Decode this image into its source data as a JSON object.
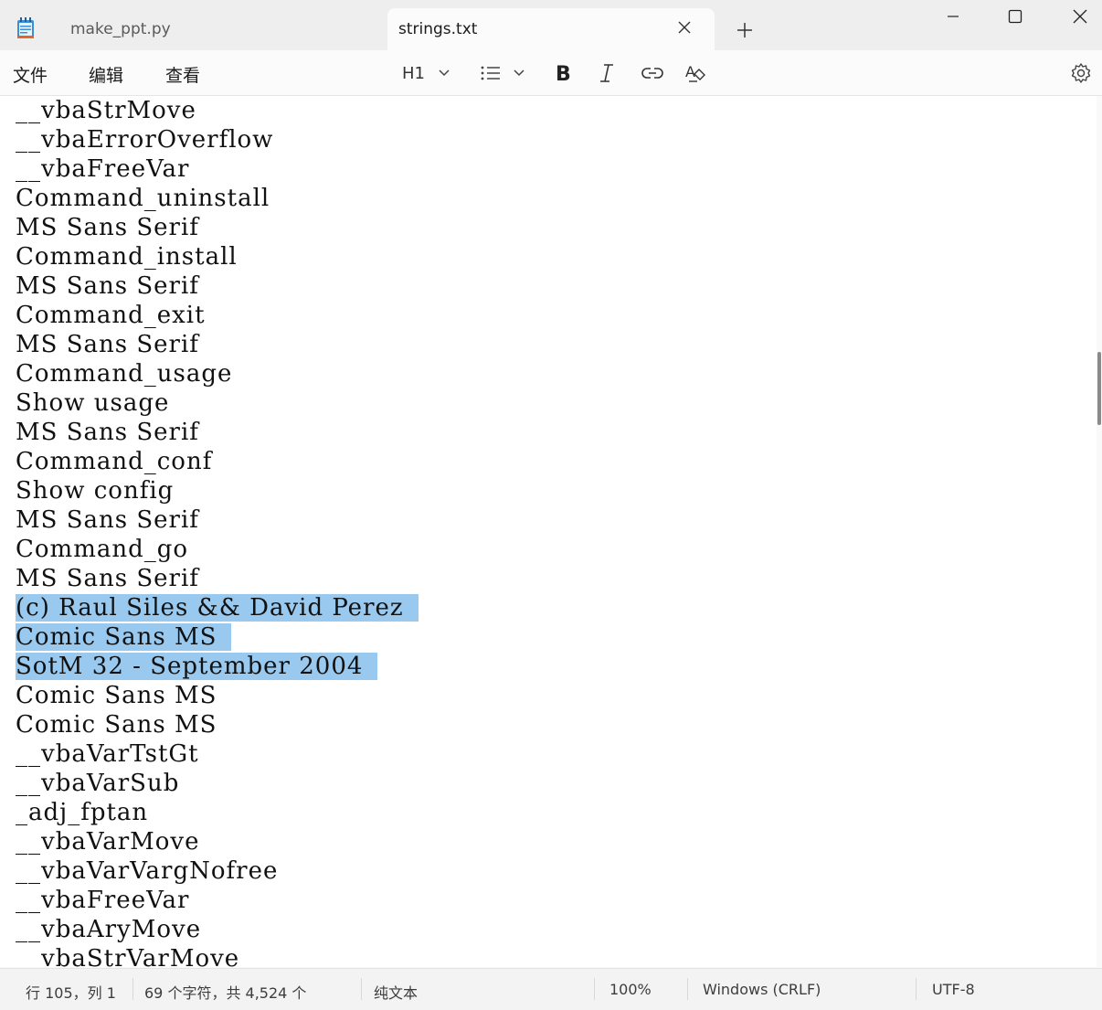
{
  "tabs": [
    {
      "label": "make_ppt.py",
      "icon": "notepad-icon"
    },
    {
      "label": "strings.txt",
      "active": true
    }
  ],
  "menu": [
    "文件",
    "编辑",
    "查看"
  ],
  "toolbar": {
    "heading": "H1",
    "icons": [
      "chevron-down-icon",
      "list-icon",
      "bold-icon",
      "italic-icon",
      "link-icon",
      "clear-format-icon",
      "gear-icon"
    ]
  },
  "editor": {
    "lines": [
      "__vbaStrMove",
      "__vbaErrorOverflow",
      "__vbaFreeVar",
      "Command_uninstall",
      "MS Sans Serif",
      "Command_install",
      "MS Sans Serif",
      "Command_exit",
      "MS Sans Serif",
      "Command_usage",
      "Show usage",
      "MS Sans Serif",
      "Command_conf",
      "Show config",
      "MS Sans Serif",
      "Command_go",
      "MS Sans Serif",
      "(c) Raul Siles && David Perez",
      "Comic Sans MS",
      "SotM 32 - September 2004",
      "Comic Sans MS",
      "Comic Sans MS",
      "__vbaVarTstGt",
      "__vbaVarSub",
      "_adj_fptan",
      "__vbaVarMove",
      "__vbaVarVargNofree",
      "__vbaFreeVar",
      "__vbaAryMove",
      "__vbaStrVarMove"
    ],
    "selected_lines": [
      17,
      18,
      19
    ]
  },
  "status": {
    "position": "行 105，列 1",
    "count": "69 个字符，共 4,524 个",
    "format": "纯文本",
    "zoom": "100%",
    "line_ending": "Windows (CRLF)",
    "encoding": "UTF-8"
  },
  "colors": {
    "selection": "#99c9ef",
    "app_icon": "#3b8fd6"
  }
}
